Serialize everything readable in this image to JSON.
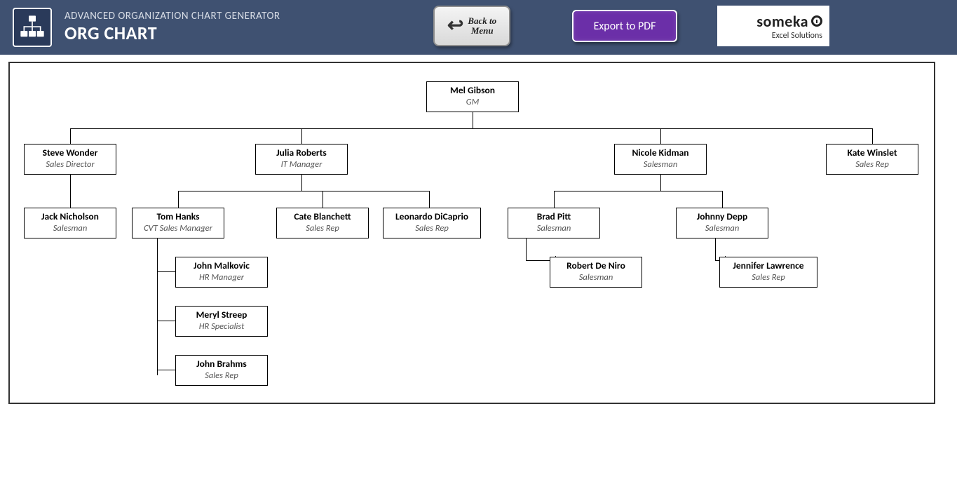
{
  "header": {
    "subtitle": "ADVANCED ORGANIZATION CHART GENERATOR",
    "title": "ORG CHART",
    "back_button": "Back to\nMenu",
    "pdf_button": "Export to PDF",
    "logo_brand": "someka",
    "logo_tag": "Excel Solutions"
  },
  "nodes": {
    "root": {
      "name": "Mel Gibson",
      "title": "GM"
    },
    "l1a": {
      "name": "Steve Wonder",
      "title": "Sales Director"
    },
    "l1b": {
      "name": "Julia Roberts",
      "title": "IT Manager"
    },
    "l1c": {
      "name": "Nicole Kidman",
      "title": "Salesman"
    },
    "l1d": {
      "name": "Kate Winslet",
      "title": "Sales Rep"
    },
    "l2a": {
      "name": "Jack Nicholson",
      "title": "Salesman"
    },
    "l2b": {
      "name": "Tom Hanks",
      "title": "CVT Sales Manager"
    },
    "l2c": {
      "name": "Cate Blanchett",
      "title": "Sales Rep"
    },
    "l2d": {
      "name": "Leonardo DiCaprio",
      "title": "Sales Rep"
    },
    "l2e": {
      "name": "Brad Pitt",
      "title": "Salesman"
    },
    "l2f": {
      "name": "Johnny Depp",
      "title": "Salesman"
    },
    "l3b1": {
      "name": "John Malkovic",
      "title": "HR Manager"
    },
    "l3b2": {
      "name": "Meryl Streep",
      "title": "HR Specialist"
    },
    "l3b3": {
      "name": "John Brahms",
      "title": "Sales Rep"
    },
    "l3e1": {
      "name": "Robert De Niro",
      "title": "Salesman"
    },
    "l3f1": {
      "name": "Jennifer Lawrence",
      "title": "Sales Rep"
    }
  },
  "chart_data": {
    "type": "org-tree",
    "root": {
      "name": "Mel Gibson",
      "title": "GM",
      "children": [
        {
          "name": "Steve Wonder",
          "title": "Sales Director",
          "children": [
            {
              "name": "Jack Nicholson",
              "title": "Salesman"
            }
          ]
        },
        {
          "name": "Julia Roberts",
          "title": "IT Manager",
          "children": [
            {
              "name": "Tom Hanks",
              "title": "CVT Sales Manager",
              "children": [
                {
                  "name": "John Malkovic",
                  "title": "HR Manager"
                },
                {
                  "name": "Meryl Streep",
                  "title": "HR Specialist"
                },
                {
                  "name": "John Brahms",
                  "title": "Sales Rep"
                }
              ]
            },
            {
              "name": "Cate Blanchett",
              "title": "Sales Rep"
            },
            {
              "name": "Leonardo DiCaprio",
              "title": "Sales Rep"
            }
          ]
        },
        {
          "name": "Nicole Kidman",
          "title": "Salesman",
          "children": [
            {
              "name": "Brad Pitt",
              "title": "Salesman",
              "children": [
                {
                  "name": "Robert De Niro",
                  "title": "Salesman"
                }
              ]
            },
            {
              "name": "Johnny Depp",
              "title": "Salesman",
              "children": [
                {
                  "name": "Jennifer Lawrence",
                  "title": "Sales Rep"
                }
              ]
            }
          ]
        },
        {
          "name": "Kate Winslet",
          "title": "Sales Rep"
        }
      ]
    }
  }
}
